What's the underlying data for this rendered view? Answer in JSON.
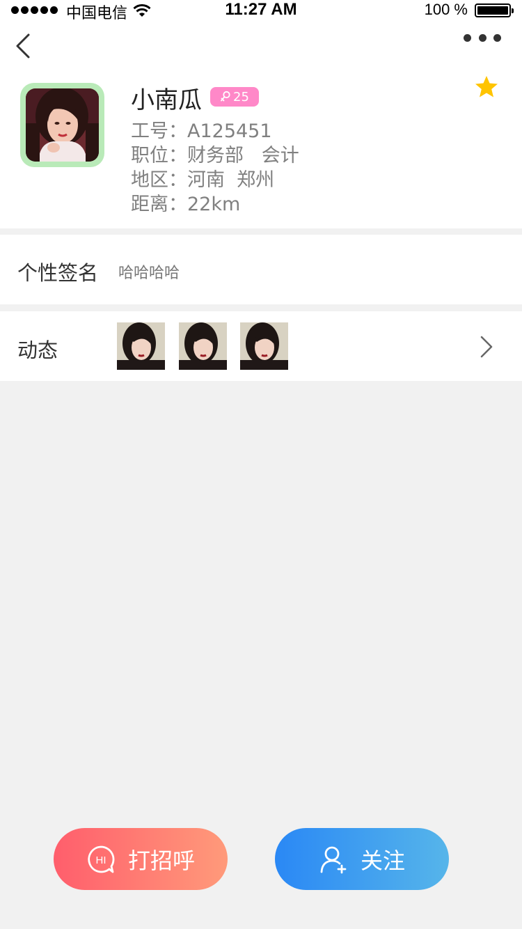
{
  "status_bar": {
    "carrier": "中国电信",
    "time": "11:27 AM",
    "battery": "100 %"
  },
  "profile": {
    "name": "小南瓜",
    "age": "25",
    "gender_icon": "female-icon",
    "favorite_icon": "star-icon",
    "id_line": "工号：A125451",
    "position_line": "职位：财务部   会计",
    "region_line": "地区：河南  郑州",
    "distance_line": "距离：22km"
  },
  "signature": {
    "label": "个性签名",
    "text": "哈哈哈哈"
  },
  "feed": {
    "label": "动态",
    "thumbnail_count": 3
  },
  "actions": {
    "greet_label": "打招呼",
    "greet_icon": "HI",
    "follow_label": "关注"
  },
  "colors": {
    "avatar_border": "#b9eab8",
    "age_badge": "#ff88c8",
    "star": "#ffc400",
    "greet_gradient": [
      "#ff5e6c",
      "#ff9a7a"
    ],
    "follow_gradient": [
      "#2a88f5",
      "#56b5ea"
    ],
    "page_bg": "#f1f1f1"
  }
}
